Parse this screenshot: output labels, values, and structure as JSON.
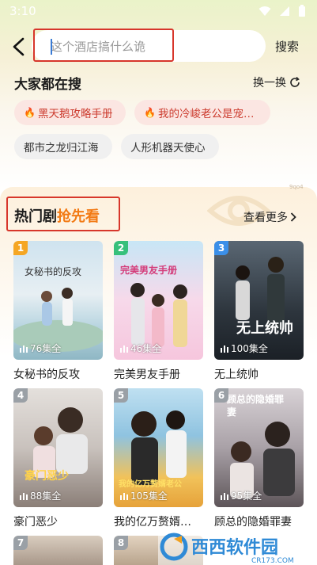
{
  "status": {
    "time": "3:10"
  },
  "search": {
    "placeholder": "这个酒店搞什么诡",
    "button": "搜索"
  },
  "hot_search": {
    "title": "大家都在搜",
    "refresh": "换一换",
    "tags": [
      "黑天鹅攻略手册",
      "我的冷峻老公是宠…",
      "都市之龙归江海",
      "人形机器天使心"
    ]
  },
  "section": {
    "title_a": "热门剧",
    "title_b": "抢先看",
    "more": "查看更多",
    "small_mark": "9qo4"
  },
  "dramas": [
    {
      "rank": "1",
      "title": "女秘书的反攻",
      "episodes": "76集全",
      "poster_text": "女秘书的反攻"
    },
    {
      "rank": "2",
      "title": "完美男友手册",
      "episodes": "46集全",
      "poster_text": "完美男友手册"
    },
    {
      "rank": "3",
      "title": "无上统帅",
      "episodes": "100集全",
      "poster_text": "无上统帅"
    },
    {
      "rank": "4",
      "title": "豪门恶少",
      "episodes": "88集全",
      "poster_text": "豪门恶少"
    },
    {
      "rank": "5",
      "title": "我的亿万赘婿…",
      "episodes": "105集全",
      "poster_text": "我的亿万赘婿老公"
    },
    {
      "rank": "6",
      "title": "顾总的隐婚罪妻",
      "episodes": "95集全",
      "poster_text": "顾总的隐婚罪妻"
    },
    {
      "rank": "7"
    },
    {
      "rank": "8"
    }
  ],
  "watermark": {
    "name": "西西软件园",
    "site": "CR173.COM"
  },
  "colors": {
    "accent": "#f27a14",
    "rank1": "#f5a623",
    "rank2": "#37c07b",
    "rank3": "#3b8fe8",
    "rank_other": "#9aa0a6"
  }
}
